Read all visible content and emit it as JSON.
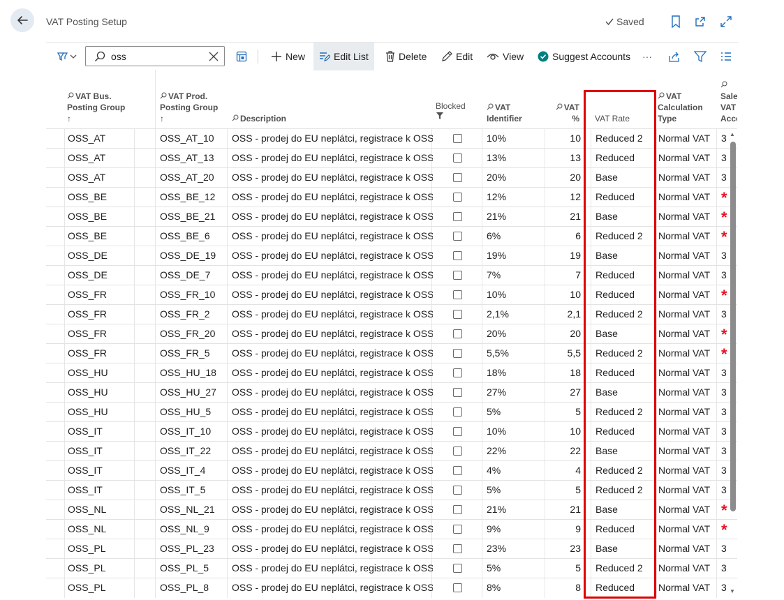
{
  "page": {
    "title": "VAT Posting Setup",
    "saved_label": "Saved"
  },
  "toolbar": {
    "search_value": "oss",
    "new_label": "New",
    "edit_list_label": "Edit List",
    "delete_label": "Delete",
    "edit_label": "Edit",
    "view_label": "View",
    "suggest_accounts_label": "Suggest Accounts",
    "more_label": "···"
  },
  "columns": {
    "bus_group": [
      "VAT Bus.",
      "Posting Group"
    ],
    "prod_group": [
      "VAT Prod.",
      "Posting Group"
    ],
    "description": "Description",
    "blocked": "Blocked",
    "vat_identifier": [
      "VAT",
      "Identifier"
    ],
    "vat_percent": [
      "VAT",
      "%"
    ],
    "vat_rate": "VAT Rate",
    "vat_calc_type": [
      "VAT",
      "Calculation",
      "Type"
    ],
    "sales_account": [
      "Sales",
      "VAT",
      "Acco"
    ],
    "sort_arrow": "↑"
  },
  "rows": [
    {
      "bus": "OSS_AT",
      "prod": "OSS_AT_10",
      "desc": "OSS - prodej do EU neplátci, registrace k OSS",
      "ident": "10%",
      "pct": "10",
      "rate": "Reduced 2",
      "calc": "Normal VAT",
      "acct": "3",
      "missing": false
    },
    {
      "bus": "OSS_AT",
      "prod": "OSS_AT_13",
      "desc": "OSS - prodej do EU neplátci, registrace k OSS",
      "ident": "13%",
      "pct": "13",
      "rate": "Reduced",
      "calc": "Normal VAT",
      "acct": "3",
      "missing": false
    },
    {
      "bus": "OSS_AT",
      "prod": "OSS_AT_20",
      "desc": "OSS - prodej do EU neplátci, registrace k OSS",
      "ident": "20%",
      "pct": "20",
      "rate": "Base",
      "calc": "Normal VAT",
      "acct": "3",
      "missing": false
    },
    {
      "bus": "OSS_BE",
      "prod": "OSS_BE_12",
      "desc": "OSS - prodej do EU neplátci, registrace k OSS",
      "ident": "12%",
      "pct": "12",
      "rate": "Reduced",
      "calc": "Normal VAT",
      "acct": "*",
      "missing": true
    },
    {
      "bus": "OSS_BE",
      "prod": "OSS_BE_21",
      "desc": "OSS - prodej do EU neplátci, registrace k OSS",
      "ident": "21%",
      "pct": "21",
      "rate": "Base",
      "calc": "Normal VAT",
      "acct": "*",
      "missing": true
    },
    {
      "bus": "OSS_BE",
      "prod": "OSS_BE_6",
      "desc": "OSS - prodej do EU neplátci, registrace k OSS",
      "ident": "6%",
      "pct": "6",
      "rate": "Reduced 2",
      "calc": "Normal VAT",
      "acct": "*",
      "missing": true
    },
    {
      "bus": "OSS_DE",
      "prod": "OSS_DE_19",
      "desc": "OSS - prodej do EU neplátci, registrace k OSS",
      "ident": "19%",
      "pct": "19",
      "rate": "Base",
      "calc": "Normal VAT",
      "acct": "3",
      "missing": false
    },
    {
      "bus": "OSS_DE",
      "prod": "OSS_DE_7",
      "desc": "OSS - prodej do EU neplátci, registrace k OSS",
      "ident": "7%",
      "pct": "7",
      "rate": "Reduced",
      "calc": "Normal VAT",
      "acct": "3",
      "missing": false
    },
    {
      "bus": "OSS_FR",
      "prod": "OSS_FR_10",
      "desc": "OSS - prodej do EU neplátci, registrace k OSS",
      "ident": "10%",
      "pct": "10",
      "rate": "Reduced",
      "calc": "Normal VAT",
      "acct": "*",
      "missing": true
    },
    {
      "bus": "OSS_FR",
      "prod": "OSS_FR_2",
      "desc": "OSS - prodej do EU neplátci, registrace k OSS",
      "ident": "2,1%",
      "pct": "2,1",
      "rate": "Reduced 2",
      "calc": "Normal VAT",
      "acct": "3",
      "missing": false
    },
    {
      "bus": "OSS_FR",
      "prod": "OSS_FR_20",
      "desc": "OSS - prodej do EU neplátci, registrace k OSS",
      "ident": "20%",
      "pct": "20",
      "rate": "Base",
      "calc": "Normal VAT",
      "acct": "*",
      "missing": true
    },
    {
      "bus": "OSS_FR",
      "prod": "OSS_FR_5",
      "desc": "OSS - prodej do EU neplátci, registrace k OSS",
      "ident": "5,5%",
      "pct": "5,5",
      "rate": "Reduced 2",
      "calc": "Normal VAT",
      "acct": "*",
      "missing": true
    },
    {
      "bus": "OSS_HU",
      "prod": "OSS_HU_18",
      "desc": "OSS - prodej do EU neplátci, registrace k OSS",
      "ident": "18%",
      "pct": "18",
      "rate": "Reduced",
      "calc": "Normal VAT",
      "acct": "3",
      "missing": false
    },
    {
      "bus": "OSS_HU",
      "prod": "OSS_HU_27",
      "desc": "OSS - prodej do EU neplátci, registrace k OSS",
      "ident": "27%",
      "pct": "27",
      "rate": "Base",
      "calc": "Normal VAT",
      "acct": "3",
      "missing": false
    },
    {
      "bus": "OSS_HU",
      "prod": "OSS_HU_5",
      "desc": "OSS - prodej do EU neplátci, registrace k OSS",
      "ident": "5%",
      "pct": "5",
      "rate": "Reduced 2",
      "calc": "Normal VAT",
      "acct": "3",
      "missing": false
    },
    {
      "bus": "OSS_IT",
      "prod": "OSS_IT_10",
      "desc": "OSS - prodej do EU neplátci, registrace k OSS",
      "ident": "10%",
      "pct": "10",
      "rate": "Reduced",
      "calc": "Normal VAT",
      "acct": "3",
      "missing": false
    },
    {
      "bus": "OSS_IT",
      "prod": "OSS_IT_22",
      "desc": "OSS - prodej do EU neplátci, registrace k OSS",
      "ident": "22%",
      "pct": "22",
      "rate": "Base",
      "calc": "Normal VAT",
      "acct": "3",
      "missing": false
    },
    {
      "bus": "OSS_IT",
      "prod": "OSS_IT_4",
      "desc": "OSS - prodej do EU neplátci, registrace k OSS",
      "ident": "4%",
      "pct": "4",
      "rate": "Reduced 2",
      "calc": "Normal VAT",
      "acct": "3",
      "missing": false
    },
    {
      "bus": "OSS_IT",
      "prod": "OSS_IT_5",
      "desc": "OSS - prodej do EU neplátci, registrace k OSS",
      "ident": "5%",
      "pct": "5",
      "rate": "Reduced 2",
      "calc": "Normal VAT",
      "acct": "3",
      "missing": false
    },
    {
      "bus": "OSS_NL",
      "prod": "OSS_NL_21",
      "desc": "OSS - prodej do EU neplátci, registrace k OSS",
      "ident": "21%",
      "pct": "21",
      "rate": "Base",
      "calc": "Normal VAT",
      "acct": "*",
      "missing": true
    },
    {
      "bus": "OSS_NL",
      "prod": "OSS_NL_9",
      "desc": "OSS - prodej do EU neplátci, registrace k OSS",
      "ident": "9%",
      "pct": "9",
      "rate": "Reduced",
      "calc": "Normal VAT",
      "acct": "*",
      "missing": true
    },
    {
      "bus": "OSS_PL",
      "prod": "OSS_PL_23",
      "desc": "OSS - prodej do EU neplátci, registrace k OSS",
      "ident": "23%",
      "pct": "23",
      "rate": "Base",
      "calc": "Normal VAT",
      "acct": "3",
      "missing": false
    },
    {
      "bus": "OSS_PL",
      "prod": "OSS_PL_5",
      "desc": "OSS - prodej do EU neplátci, registrace k OSS",
      "ident": "5%",
      "pct": "5",
      "rate": "Reduced 2",
      "calc": "Normal VAT",
      "acct": "3",
      "missing": false
    },
    {
      "bus": "OSS_PL",
      "prod": "OSS_PL_8",
      "desc": "OSS - prodej do EU neplátci, registrace k OSS",
      "ident": "8%",
      "pct": "8",
      "rate": "Reduced",
      "calc": "Normal VAT",
      "acct": "3",
      "missing": false
    }
  ],
  "colors": {
    "highlight": "#e00000",
    "required_star": "#e81123",
    "accent_teal": "#008080",
    "active_button_bg": "#e9ecef"
  },
  "icons": {
    "back": "arrow-left-icon",
    "saved": "checkmark-icon",
    "bookmark": "bookmark-icon",
    "open_new": "open-in-new-window-icon",
    "expand": "expand-icon",
    "filter_pane": "filter-pane-icon",
    "search": "search-icon",
    "clear": "close-icon",
    "analysis": "analysis-mode-icon",
    "new": "plus-icon",
    "edit_list": "edit-list-icon",
    "delete": "trash-icon",
    "edit": "pencil-icon",
    "view": "eye-icon",
    "suggest": "check-circle-icon",
    "share": "share-icon",
    "filter": "filter-icon",
    "list_view": "list-view-icon"
  }
}
